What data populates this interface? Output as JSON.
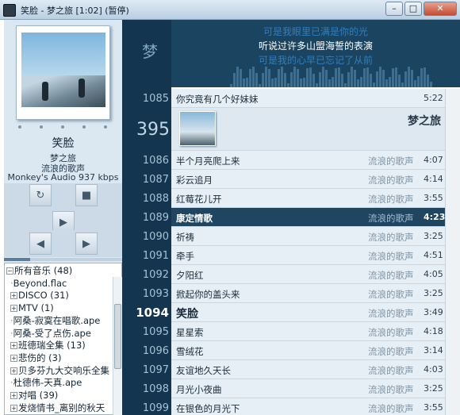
{
  "window": {
    "title": "笑脸 - 梦之旅 [1:02] (暂停)",
    "minimize_glyph": "–",
    "maximize_glyph": "□",
    "close_glyph": "✕"
  },
  "now_playing": {
    "title": "笑脸",
    "album": "梦之旅",
    "artist": "流浪的歌声",
    "codec": "Monkey's Audio  937 kbps",
    "progress": 0.22
  },
  "controls": {
    "repeat": "↻",
    "stop": "■",
    "play": "▶",
    "prev": "◀",
    "next": "▶"
  },
  "library": [
    {
      "label": "所有音乐 (48)",
      "pm": "−",
      "indent": 0
    },
    {
      "label": "Beyond.flac",
      "pm": "",
      "indent": 1
    },
    {
      "label": "DISCO (31)",
      "pm": "+",
      "indent": 1
    },
    {
      "label": "MTV (1)",
      "pm": "+",
      "indent": 1
    },
    {
      "label": "阿桑-寂寞在唱歌.ape",
      "pm": "",
      "indent": 1
    },
    {
      "label": "阿桑-受了点伤.ape",
      "pm": "",
      "indent": 1
    },
    {
      "label": "班德瑞全集 (13)",
      "pm": "+",
      "indent": 1
    },
    {
      "label": "悲伤的 (3)",
      "pm": "+",
      "indent": 1
    },
    {
      "label": "贝多芬九大交响乐全集",
      "pm": "+",
      "indent": 1
    },
    {
      "label": "杜德伟-天真.ape",
      "pm": "",
      "indent": 1
    },
    {
      "label": "对唱 (39)",
      "pm": "+",
      "indent": 1
    },
    {
      "label": "发烧情书_离别的秋天",
      "pm": "+",
      "indent": 1
    }
  ],
  "strip": {
    "logo": "梦",
    "album_count": "395"
  },
  "lyrics": {
    "line1": "可是我眼里已满是你的光",
    "line2": "听说过许多山盟海誓的表演",
    "line3": "可是我的心早已忘记了从前"
  },
  "playlist_header": {
    "album": "梦之旅"
  },
  "playlist": [
    {
      "num": "1085",
      "title": "你究竟有几个好妹妹",
      "artist": "",
      "dur": "5:22",
      "state": ""
    },
    {
      "num": "1086",
      "title": "半个月亮爬上来",
      "artist": "流浪的歌声",
      "dur": "4:07",
      "state": ""
    },
    {
      "num": "1087",
      "title": "彩云追月",
      "artist": "流浪的歌声",
      "dur": "4:14",
      "state": ""
    },
    {
      "num": "1088",
      "title": "红莓花儿开",
      "artist": "流浪的歌声",
      "dur": "3:55",
      "state": ""
    },
    {
      "num": "1089",
      "title": "康定情歌",
      "artist": "流浪的歌声",
      "dur": "4:23",
      "state": "sel"
    },
    {
      "num": "1090",
      "title": "祈祷",
      "artist": "流浪的歌声",
      "dur": "3:25",
      "state": ""
    },
    {
      "num": "1091",
      "title": "牵手",
      "artist": "流浪的歌声",
      "dur": "4:51",
      "state": ""
    },
    {
      "num": "1092",
      "title": "夕阳红",
      "artist": "流浪的歌声",
      "dur": "4:05",
      "state": ""
    },
    {
      "num": "1093",
      "title": "掀起你的盖头来",
      "artist": "流浪的歌声",
      "dur": "3:25",
      "state": ""
    },
    {
      "num": "1094",
      "title": "笑脸",
      "artist": "流浪的歌声",
      "dur": "3:49",
      "state": "cur"
    },
    {
      "num": "1095",
      "title": "星星索",
      "artist": "流浪的歌声",
      "dur": "4:18",
      "state": ""
    },
    {
      "num": "1096",
      "title": "雪绒花",
      "artist": "流浪的歌声",
      "dur": "3:14",
      "state": ""
    },
    {
      "num": "1097",
      "title": "友谊地久天长",
      "artist": "流浪的歌声",
      "dur": "4:03",
      "state": ""
    },
    {
      "num": "1098",
      "title": "月光小夜曲",
      "artist": "流浪的歌声",
      "dur": "3:25",
      "state": ""
    },
    {
      "num": "1099",
      "title": "在银色的月光下",
      "artist": "流浪的歌声",
      "dur": "3:55",
      "state": ""
    }
  ],
  "colors": {
    "strip_bg": "#13354f",
    "selected_row": "#1f4560",
    "lyric_highlight": "#ffffff",
    "lyric_dim": "#2f7fc4"
  }
}
